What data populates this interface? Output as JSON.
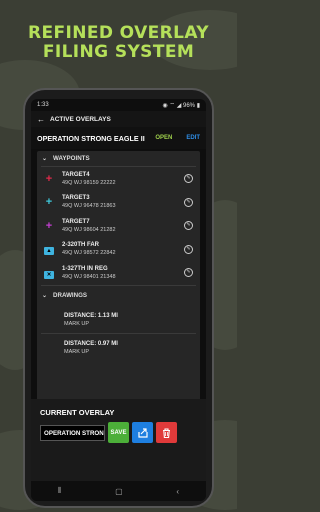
{
  "headline": [
    "REFINED OVERLAY",
    "FILING SYSTEM"
  ],
  "status": {
    "time": "1:33",
    "battery": "96%"
  },
  "appbar": {
    "title": "ACTIVE OVERLAYS"
  },
  "overlay": {
    "name": "OPERATION STRONG EAGLE II",
    "open_label": "OPEN",
    "edit_label": "EDIT"
  },
  "waypoints": {
    "section_label": "WAYPOINTS",
    "items": [
      {
        "name": "TARGET4",
        "grid": "49Q WJ 98159 22222",
        "icon": "plus-icon",
        "color": "#e02a4a"
      },
      {
        "name": "TARGET3",
        "grid": "49Q WJ 96478 21863",
        "icon": "plus-icon",
        "color": "#3fc7d9"
      },
      {
        "name": "TARGET7",
        "grid": "49Q WJ 98604 21282",
        "icon": "plus-icon",
        "color": "#c23fd0"
      },
      {
        "name": "2-320TH FAR",
        "grid": "49Q WJ 98572 22842",
        "icon": "unit-symbol-icon",
        "color": "#3fb4e0"
      },
      {
        "name": "1-327TH IN REG",
        "grid": "49Q WJ 98401 21348",
        "icon": "unit-symbol-icon",
        "color": "#3fb4e0"
      }
    ]
  },
  "drawings": {
    "section_label": "DRAWINGS",
    "items": [
      {
        "distance": "DISTANCE: 1.13 MI",
        "label": "MARK UP"
      },
      {
        "distance": "DISTANCE: 0.97 MI",
        "label": "MARK UP"
      }
    ]
  },
  "current": {
    "title": "CURRENT OVERLAY",
    "value": "OPERATION STRONG",
    "save_label": "SAVE",
    "save_color": "#4caf39",
    "share_color": "#1e7fe0",
    "delete_color": "#e03a3a"
  }
}
